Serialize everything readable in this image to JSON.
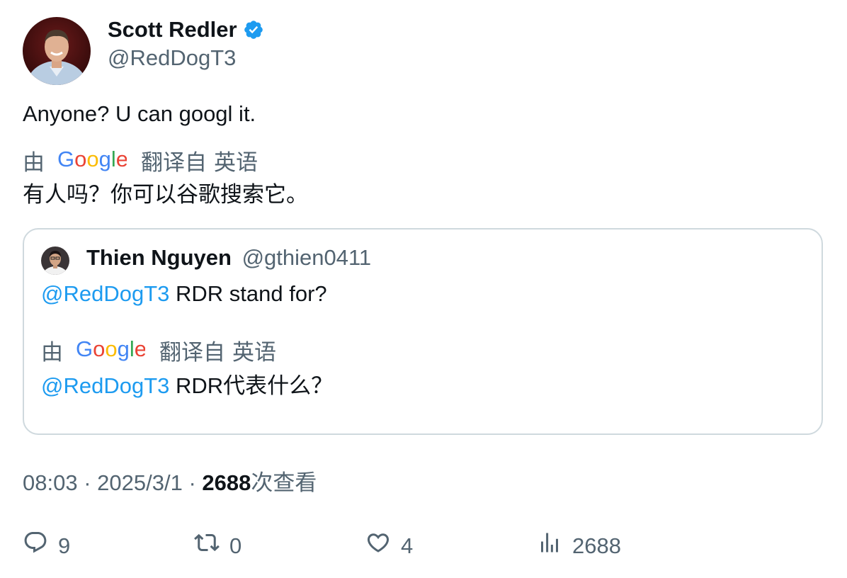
{
  "tweet": {
    "author_name": "Scott Redler",
    "author_handle": "@RedDogT3",
    "text": "Anyone? U can googl it.",
    "translation": {
      "by_label": "由",
      "logo_text": "Google",
      "from_label": "翻译自",
      "language": "英语",
      "text": "有人吗？你可以谷歌搜索它。"
    },
    "time": "08:03",
    "date": "2025/3/1",
    "separator": "·",
    "views_count": "2688",
    "views_label": "次查看"
  },
  "quote": {
    "author_name": "Thien Nguyen",
    "author_handle": "@gthien0411",
    "mention": "@RedDogT3",
    "text": " RDR stand for?",
    "translation": {
      "by_label": "由",
      "logo_text": "Google",
      "from_label": "翻译自",
      "language": "英语",
      "mention": "@RedDogT3",
      "text": " RDR代表什么？"
    }
  },
  "actions": {
    "replies": "9",
    "retweets": "0",
    "likes": "4",
    "views": "2688"
  },
  "colors": {
    "text": "#0f1419",
    "secondary": "#536471",
    "accent": "#1d9bf0",
    "border": "#cfd9de",
    "verified": "#1d9bf0"
  },
  "icons": {
    "verified": "verified-badge-icon",
    "reply": "reply-icon",
    "retweet": "retweet-icon",
    "like": "heart-icon",
    "views": "bar-chart-icon"
  }
}
